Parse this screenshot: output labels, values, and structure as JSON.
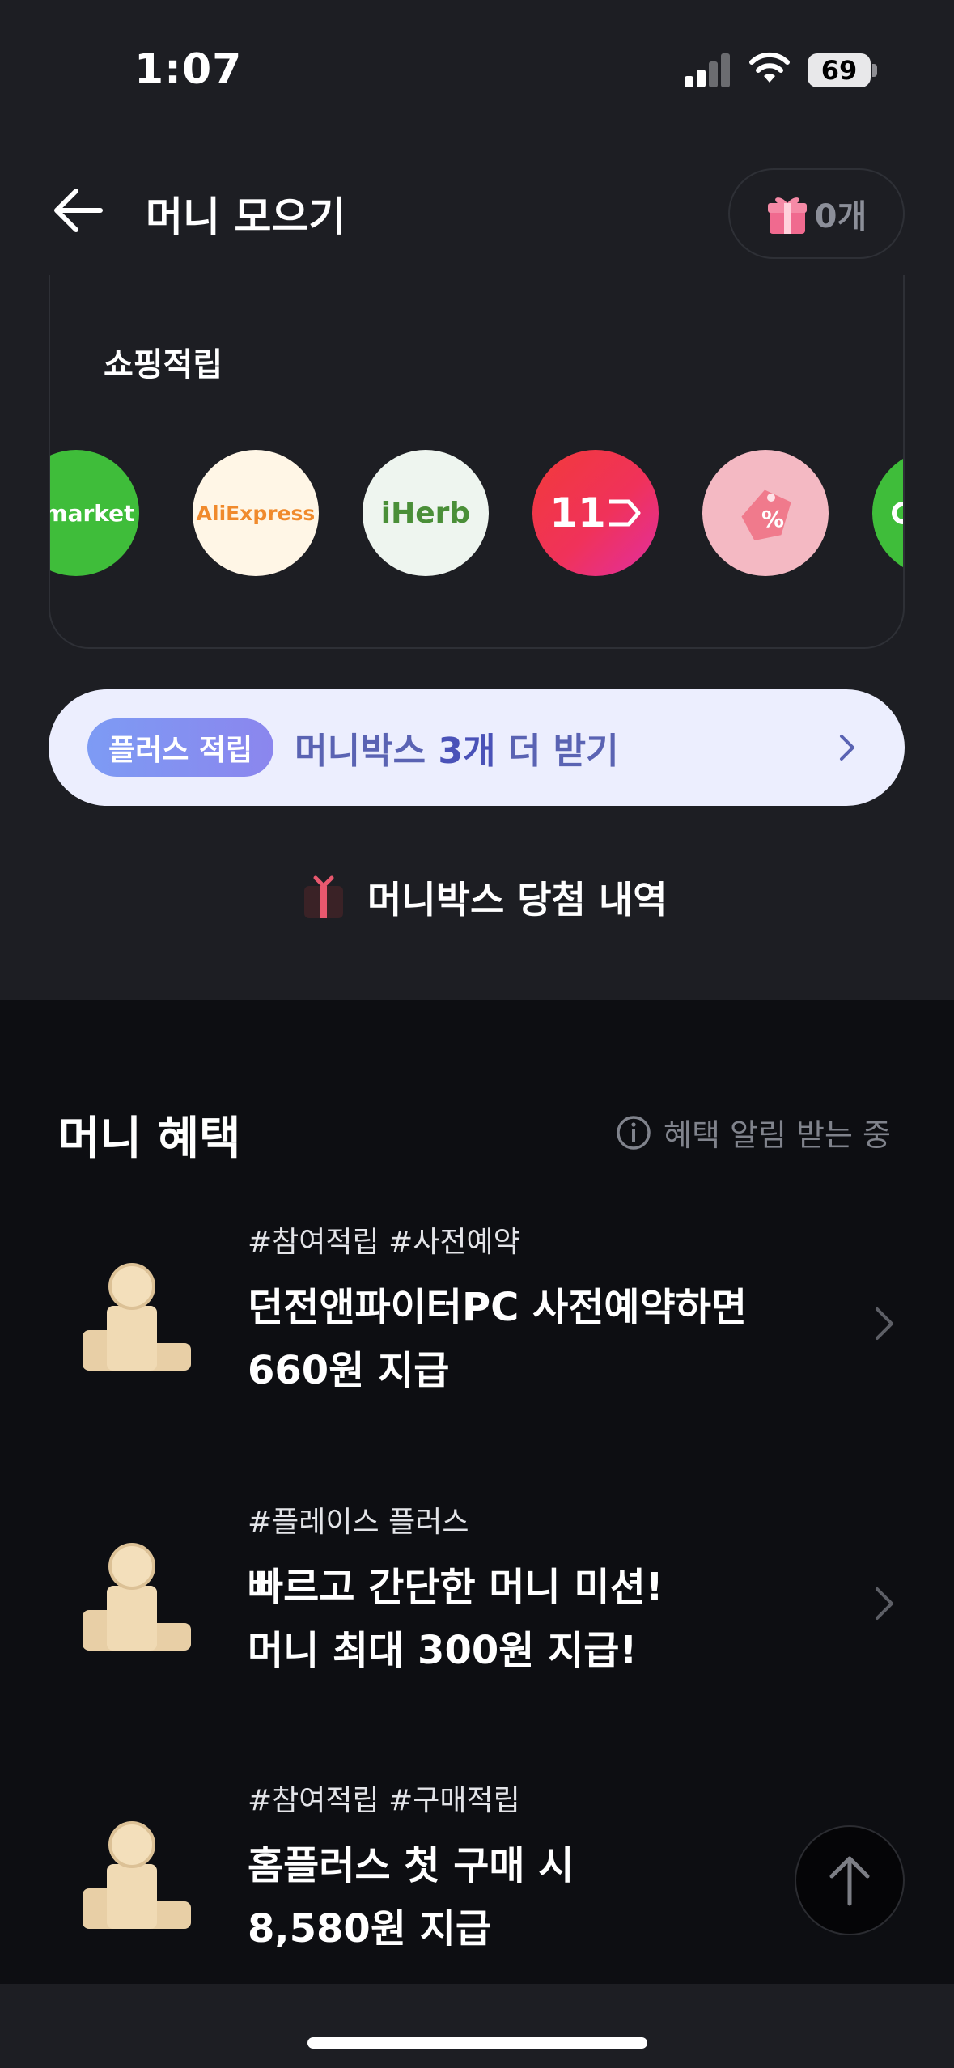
{
  "status_bar": {
    "time": "1:07",
    "battery": "69"
  },
  "header": {
    "title": "머니 모으기",
    "gift_count": "0개"
  },
  "shopping": {
    "title": "쇼핑적립",
    "logos": [
      {
        "name": "Gmarket",
        "label": "Gmarket"
      },
      {
        "name": "AliExpress",
        "label": "AliExpress"
      },
      {
        "name": "iHerb",
        "label": "iHerb"
      },
      {
        "name": "11st",
        "label": "11"
      },
      {
        "name": "coupon-tag",
        "label": "%"
      },
      {
        "name": "partial-green",
        "label": ""
      }
    ]
  },
  "plus_banner": {
    "badge": "플러스 적립",
    "text_before": "머니박스 ",
    "highlight": "3개",
    "text_after": " 더 받기"
  },
  "history_link": "머니박스 당첨 내역",
  "benefits": {
    "title": "머니 혜택",
    "notify": "혜택 알림 받는 중",
    "items": [
      {
        "tags": "#참여적립 #사전예약",
        "line1": "던전앤파이터PC 사전예약하면",
        "line2": "660원 지급"
      },
      {
        "tags": "#플레이스 플러스",
        "line1": "빠르고 간단한 머니 미션!",
        "line2": "머니 최대 300원 지급!"
      },
      {
        "tags": "#참여적립 #구매적립",
        "line1": "홈플러스 첫 구매 시",
        "line2": "8,580원 지급"
      }
    ]
  },
  "colors": {
    "accent": "#5a63b3",
    "banner_bg": "#eceefe",
    "page_bg": "#0d0e12",
    "card_bg": "#1d1e23"
  }
}
